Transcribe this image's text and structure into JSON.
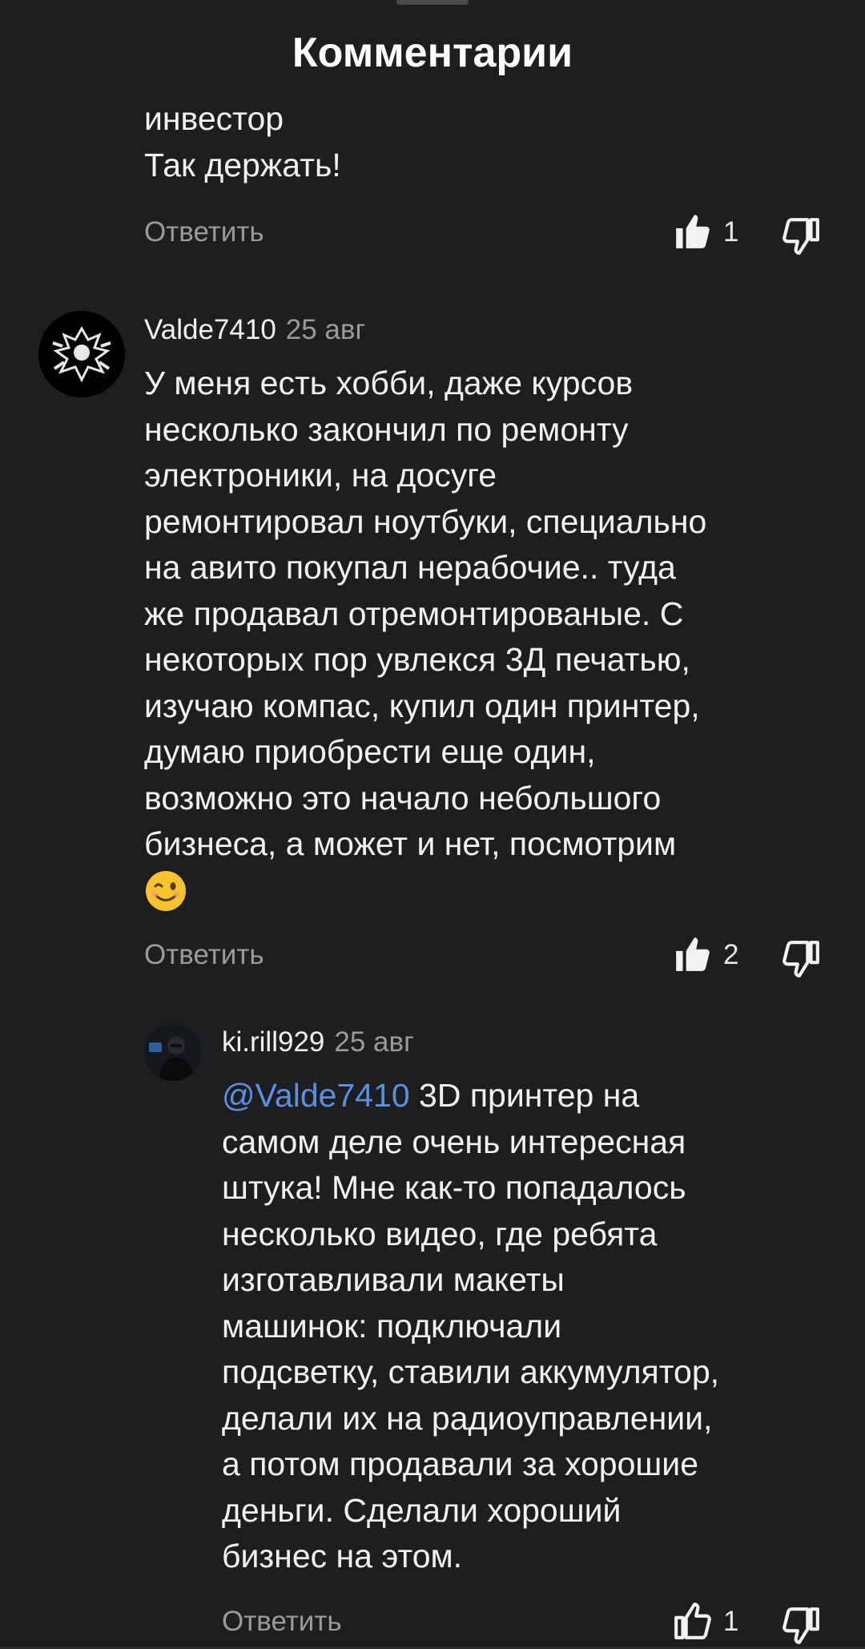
{
  "header": {
    "title": "Комментарии"
  },
  "previous_comment": {
    "lines": [
      "инвестор",
      "Так держать!"
    ],
    "reply_label": "Ответить",
    "like_count": "1"
  },
  "comment1": {
    "username": "Valde7410",
    "date": "25 авг",
    "lines": [
      "У меня есть хобби, даже курсов",
      "несколько закончил по ремонту",
      "электроники, на досуге",
      "ремонтировал ноутбуки, специально",
      "на авито покупал нерабочие.. туда",
      "же продавал отремонтированые. С",
      "некоторых пор увлекся 3Д печатью,",
      "изучаю компас, купил один принтер,",
      "думаю приобрести еще один,",
      "возможно это начало небольшого",
      "бизнеса, а может и нет, посмотрим"
    ],
    "emoji": "winking-face",
    "reply_label": "Ответить",
    "like_count": "2"
  },
  "reply1": {
    "username": "ki.rill929",
    "date": "25 авг",
    "mention": "@Valde7410",
    "first_line_rest": " 3D принтер на",
    "lines": [
      "самом деле очень интересная",
      "штука! Мне как-то попадалось",
      "несколько видео, где ребята",
      "изготавливали макеты",
      "машинок: подключали",
      "подсветку, ставили аккумулятор,",
      "делали их на радиоуправлении,",
      "а потом продавали за хорошие",
      "деньги. Сделали хороший",
      "бизнес на этом."
    ],
    "reply_label": "Ответить",
    "like_count": "1"
  }
}
